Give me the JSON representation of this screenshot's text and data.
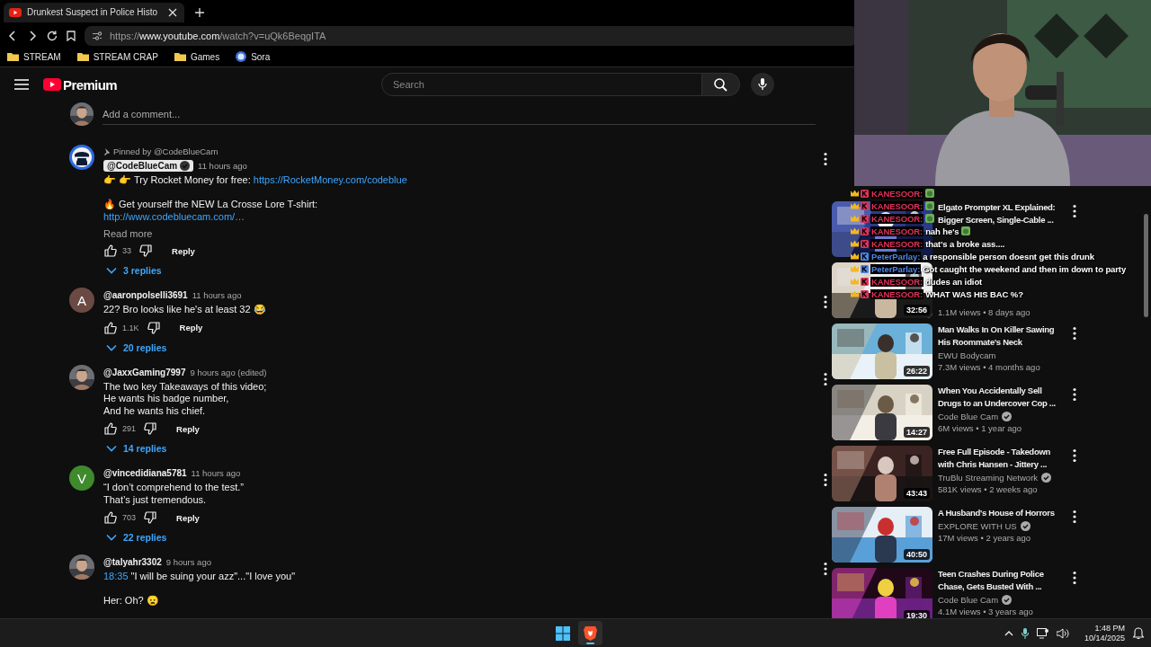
{
  "browser": {
    "tab": {
      "title": "Drunkest Suspect in Police Histo",
      "selected": true
    },
    "address": {
      "scheme": "https://",
      "host": "www.youtube.com",
      "path": "/watch?v=uQk6BeqgITA"
    },
    "bookmarks": [
      {
        "label": "STREAM",
        "kind": "folder"
      },
      {
        "label": "STREAM CRAP",
        "kind": "folder"
      },
      {
        "label": "Games",
        "kind": "folder"
      },
      {
        "label": "Sora",
        "kind": "site"
      }
    ]
  },
  "header": {
    "logo_label": "Premium",
    "search": {
      "placeholder": "Search"
    }
  },
  "comment_box": {
    "placeholder": "Add a comment..."
  },
  "comments": [
    {
      "avatar": {
        "kind": "emblem"
      },
      "pinned_by": "Pinned by @CodeBlueCam",
      "author": "@CodeBlueCam",
      "owner": true,
      "time": "11 hours ago",
      "paragraphs": [
        [
          [
            {
              "kind": "text",
              "text": "👉 👉 Try Rocket Money for free: "
            },
            {
              "kind": "link",
              "text": "https://RocketMoney.com/codeblue"
            }
          ]
        ],
        [
          [
            {
              "kind": "text",
              "text": "🔥 Get yourself the NEW La Crosse Lore T-shirt:"
            }
          ],
          [
            {
              "kind": "link",
              "text": "http://www.codebluecam.com/…"
            }
          ]
        ]
      ],
      "read_more": "Read more",
      "likes": "33",
      "reply": "Reply",
      "replies": "3 replies"
    },
    {
      "avatar": {
        "kind": "letter",
        "letter": "A",
        "color": "#6b4a44"
      },
      "author": "@aaronpolselli3691",
      "owner": false,
      "time": "11 hours ago",
      "paragraphs": [
        [
          [
            {
              "kind": "text",
              "text": "22? Bro looks like he's at least 32 😂"
            }
          ]
        ]
      ],
      "likes": "1.1K",
      "reply": "Reply",
      "replies": "20 replies"
    },
    {
      "avatar": {
        "kind": "picture"
      },
      "author": "@JaxxGaming7997",
      "owner": false,
      "time": "9 hours ago (edited)",
      "paragraphs": [
        [
          [
            {
              "kind": "text",
              "text": "The two key Takeaways of this video;"
            }
          ],
          [
            {
              "kind": "text",
              "text": "He wants his badge number,"
            }
          ],
          [
            {
              "kind": "text",
              "text": "And he wants his chief."
            }
          ]
        ]
      ],
      "likes": "291",
      "reply": "Reply",
      "replies": "14 replies"
    },
    {
      "avatar": {
        "kind": "letter",
        "letter": "V",
        "color": "#3e8a2c"
      },
      "author": "@vincedidiana5781",
      "owner": false,
      "time": "11 hours ago",
      "paragraphs": [
        [
          [
            {
              "kind": "text",
              "text": "“I don’t comprehend to the test.”"
            }
          ],
          [
            {
              "kind": "text",
              "text": "That’s just tremendous."
            }
          ]
        ]
      ],
      "likes": "703",
      "reply": "Reply",
      "replies": "22 replies"
    },
    {
      "avatar": {
        "kind": "picture"
      },
      "author": "@talyahr3302",
      "owner": false,
      "time": "9 hours ago",
      "paragraphs": [
        [
          [
            {
              "kind": "link",
              "text": "18:35"
            },
            {
              "kind": "text",
              "text": " \"I will be suing your azz\"...\"I love you\""
            }
          ]
        ],
        [
          [
            {
              "kind": "text",
              "text": "Her: Oh? 😦"
            }
          ]
        ]
      ]
    }
  ],
  "sidebar": {
    "videos": [
      {
        "title_lines": [
          "Elgato Prompter XL Explained:",
          "Bigger Screen, Single-Cable ..."
        ]
      },
      {
        "meta": "1.1M views • 8 days ago",
        "duration": "32:56"
      },
      {
        "title_lines": [
          "Man Walks In On Killer Sawing",
          "His Roommate's Neck"
        ],
        "channel": "EWU Bodycam",
        "verified": false,
        "meta": "7.3M views • 4 months ago",
        "duration": "26:22"
      },
      {
        "title_lines": [
          "When You Accidentally Sell",
          "Drugs to an Undercover Cop ..."
        ],
        "channel": "Code Blue Cam",
        "verified": true,
        "meta": "6M views • 1 year ago",
        "duration": "14:27"
      },
      {
        "title_lines": [
          "Free Full Episode - Takedown",
          "with Chris Hansen - Jittery ..."
        ],
        "channel": "TruBlu Streaming Network",
        "verified": true,
        "meta": "581K views • 2 weeks ago",
        "duration": "43:43"
      },
      {
        "title_lines": [
          "A Husband's House of Horrors"
        ],
        "channel": "EXPLORE WITH US",
        "verified": true,
        "meta": "17M views • 2 years ago",
        "duration": "40:50"
      },
      {
        "title_lines": [
          "Teen Crashes During Police",
          "Chase, Gets Busted With ..."
        ],
        "channel": "Code Blue Cam",
        "verified": true,
        "meta": "4.1M views • 3 years ago",
        "duration": "19:30"
      }
    ]
  },
  "chat": [
    {
      "user": "KANESOOR:",
      "color": "#e0325a",
      "emote": true
    },
    {
      "user": "KANESOOR:",
      "color": "#e0325a",
      "emote": true
    },
    {
      "user": "KANESOOR:",
      "color": "#e0325a",
      "emote": true
    },
    {
      "user": "KANESOOR:",
      "color": "#e0325a",
      "message": "nah he's",
      "emote": true
    },
    {
      "user": "KANESOOR:",
      "color": "#e0325a",
      "message": "that's a broke ass....",
      "emote": false
    },
    {
      "user": "PeterParlay:",
      "color": "#4f86e8",
      "message": "a responsible person doesnt get this drunk",
      "emote": false
    },
    {
      "user": "PeterParlay:",
      "color": "#4f86e8",
      "message": "Got caught the weekend and then im down to party",
      "emote": false
    },
    {
      "user": "KANESOOR:",
      "color": "#e0325a",
      "message": "dudes an idiot",
      "emote": false
    },
    {
      "user": "KANESOOR:",
      "color": "#e0325a",
      "message": "WHAT WAS HIS BAC %?",
      "emote": false
    }
  ],
  "taskbar": {
    "apps": [
      {
        "kind": "start",
        "selected": false
      },
      {
        "kind": "browser",
        "selected": true
      }
    ],
    "time": "1:48 PM",
    "date": "10/14/2025"
  }
}
